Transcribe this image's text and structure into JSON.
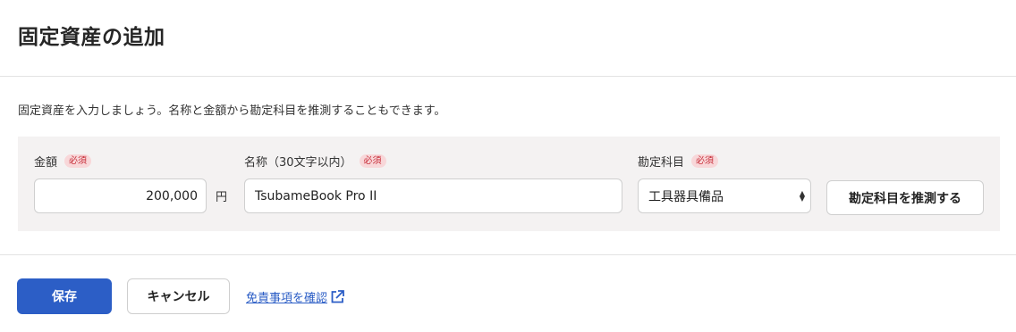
{
  "dialog": {
    "title": "固定資産の追加",
    "description": "固定資産を入力しましょう。名称と金額から勘定科目を推測することもできます。"
  },
  "form": {
    "amount": {
      "label": "金額",
      "required_badge": "必須",
      "value": "200,000",
      "unit": "円"
    },
    "name": {
      "label": "名称（30文字以内）",
      "required_badge": "必須",
      "value": "TsubameBook Pro II"
    },
    "account": {
      "label": "勘定科目",
      "required_badge": "必須",
      "selected": "工具器具備品"
    },
    "guess_button": "勘定科目を推測する"
  },
  "footer": {
    "save_label": "保存",
    "cancel_label": "キャンセル",
    "disclaimer_link": "免責事項を確認"
  },
  "colors": {
    "primary": "#2c5ec6",
    "badge_bg": "#f8d7d9",
    "badge_text": "#c72f3a",
    "panel_bg": "#f4f2f2"
  }
}
